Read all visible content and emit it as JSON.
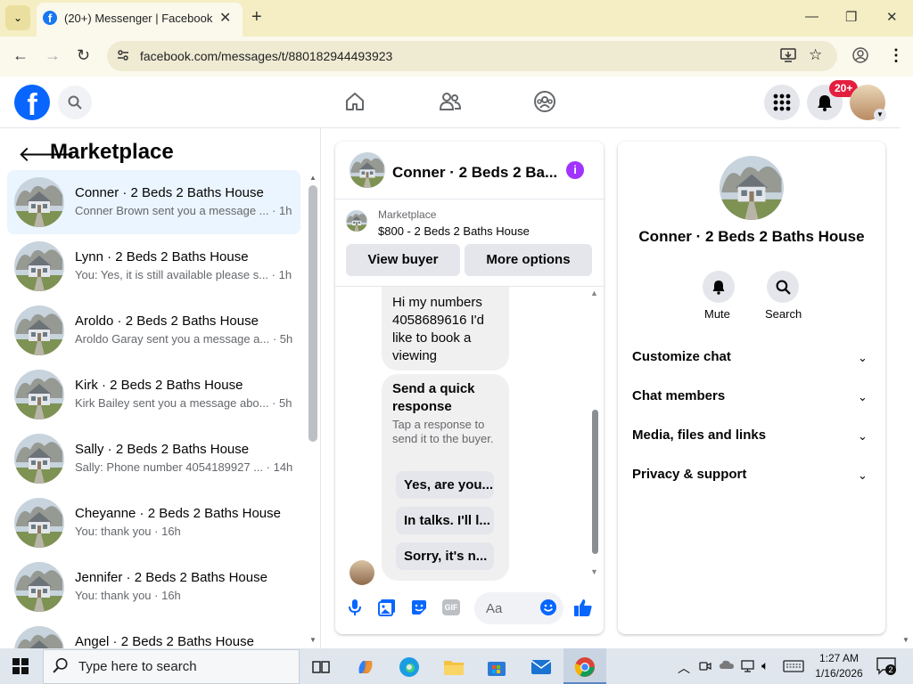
{
  "browser": {
    "tab_title": "(20+) Messenger | Facebook",
    "url": "facebook.com/messages/t/880182944493923"
  },
  "header": {
    "logo": "f",
    "notification_badge": "20+"
  },
  "marketplace": {
    "title": "Marketplace",
    "conversations": [
      {
        "name": "Conner · 2 Beds 2 Baths House",
        "preview": "Conner Brown sent you a message ... · 1h",
        "active": true
      },
      {
        "name": "Lynn · 2 Beds 2 Baths House",
        "preview": "You: Yes, it is still available please s... · 1h"
      },
      {
        "name": "Aroldo · 2 Beds 2 Baths House",
        "preview": "Aroldo Garay sent you a message a... · 5h"
      },
      {
        "name": "Kirk · 2 Beds 2 Baths House",
        "preview": "Kirk Bailey sent you a message abo... · 5h"
      },
      {
        "name": "Sally · 2 Beds 2 Baths House",
        "preview": "Sally: Phone number 4054189927 ... · 14h"
      },
      {
        "name": "Cheyanne · 2 Beds 2 Baths House",
        "preview": "You: thank you · 16h"
      },
      {
        "name": "Jennifer · 2 Beds 2 Baths House",
        "preview": "You: thank you · 16h"
      },
      {
        "name": "Angel · 2 Beds 2 Baths House",
        "preview": ""
      }
    ]
  },
  "chat": {
    "title": "Conner · 2 Beds 2 Ba...",
    "marketplace_label": "Marketplace",
    "listing": "$800 - 2 Beds 2 Baths House",
    "view_buyer": "View buyer",
    "more_options": "More options",
    "message": "Hi my numbers 4058689616 I'd like to book a viewing",
    "quick_response_title": "Send a quick response",
    "quick_response_sub": "Tap a response to send it to the buyer.",
    "quick_replies": [
      "Yes, are you...",
      "In talks. I'll l...",
      "Sorry, it's n..."
    ],
    "composer_placeholder": "Aa",
    "gif_label": "GIF"
  },
  "details": {
    "title": "Conner · 2 Beds 2 Baths House",
    "mute": "Mute",
    "search": "Search",
    "sections": [
      "Customize chat",
      "Chat members",
      "Media, files and links",
      "Privacy & support"
    ]
  },
  "taskbar": {
    "search_placeholder": "Type here to search",
    "time": "1:27 AM",
    "date": "1/16/2026",
    "notif_count": "2"
  }
}
